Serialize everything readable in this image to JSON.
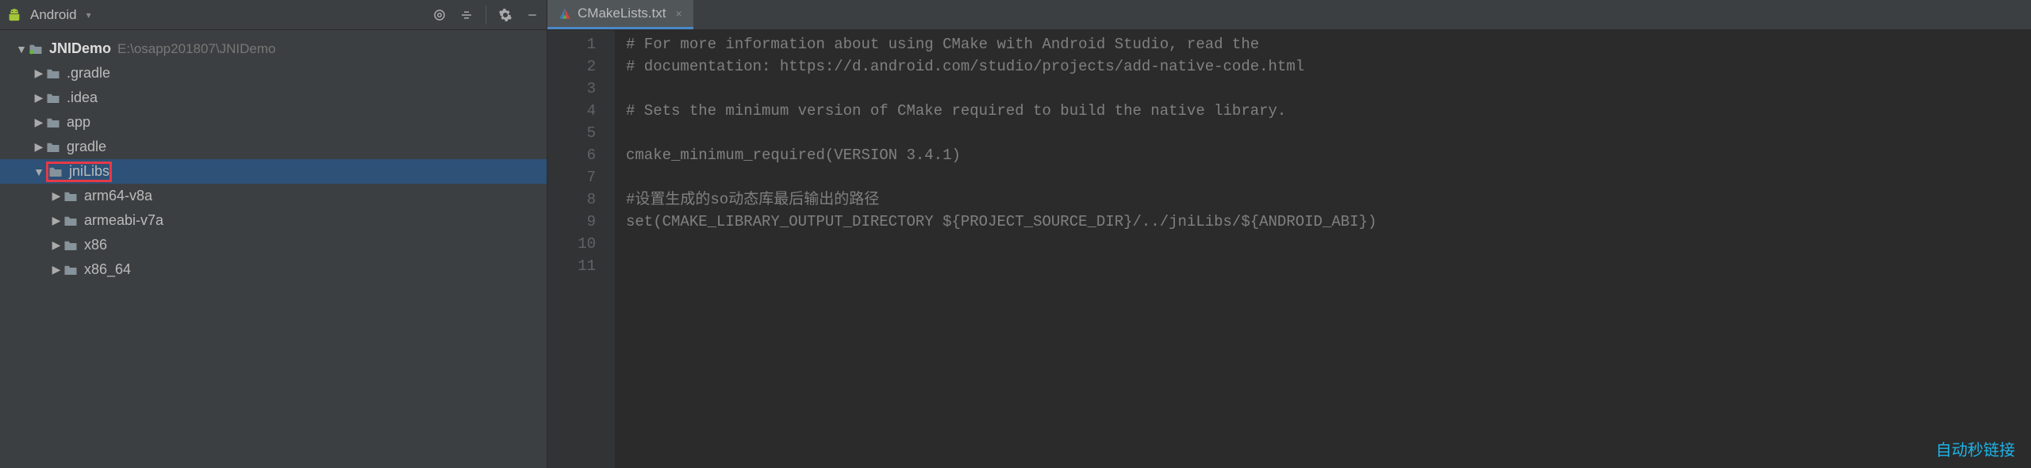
{
  "toolbar": {
    "project_view_label": "Android"
  },
  "tree": {
    "root": {
      "name": "JNIDemo",
      "path": "E:\\osapp201807\\JNIDemo"
    },
    "items": [
      {
        "label": ".gradle",
        "level": 2,
        "expanded": false
      },
      {
        "label": ".idea",
        "level": 2,
        "expanded": false
      },
      {
        "label": "app",
        "level": 2,
        "expanded": false
      },
      {
        "label": "gradle",
        "level": 2,
        "expanded": false
      },
      {
        "label": "jniLibs",
        "level": 2,
        "expanded": true,
        "highlighted": true,
        "selected": true
      },
      {
        "label": "arm64-v8a",
        "level": 3,
        "expanded": false
      },
      {
        "label": "armeabi-v7a",
        "level": 3,
        "expanded": false
      },
      {
        "label": "x86",
        "level": 3,
        "expanded": false
      },
      {
        "label": "x86_64",
        "level": 3,
        "expanded": false
      }
    ]
  },
  "tab": {
    "label": "CMakeLists.txt"
  },
  "editor": {
    "lines": [
      "# For more information about using CMake with Android Studio, read the",
      "# documentation: https://d.android.com/studio/projects/add-native-code.html",
      "",
      "# Sets the minimum version of CMake required to build the native library.",
      "",
      "cmake_minimum_required(VERSION 3.4.1)",
      "",
      "#设置生成的so动态库最后输出的路径",
      "set(CMAKE_LIBRARY_OUTPUT_DIRECTORY ${PROJECT_SOURCE_DIR}/../jniLibs/${ANDROID_ABI})",
      "",
      ""
    ]
  },
  "watermark": "自动秒链接"
}
